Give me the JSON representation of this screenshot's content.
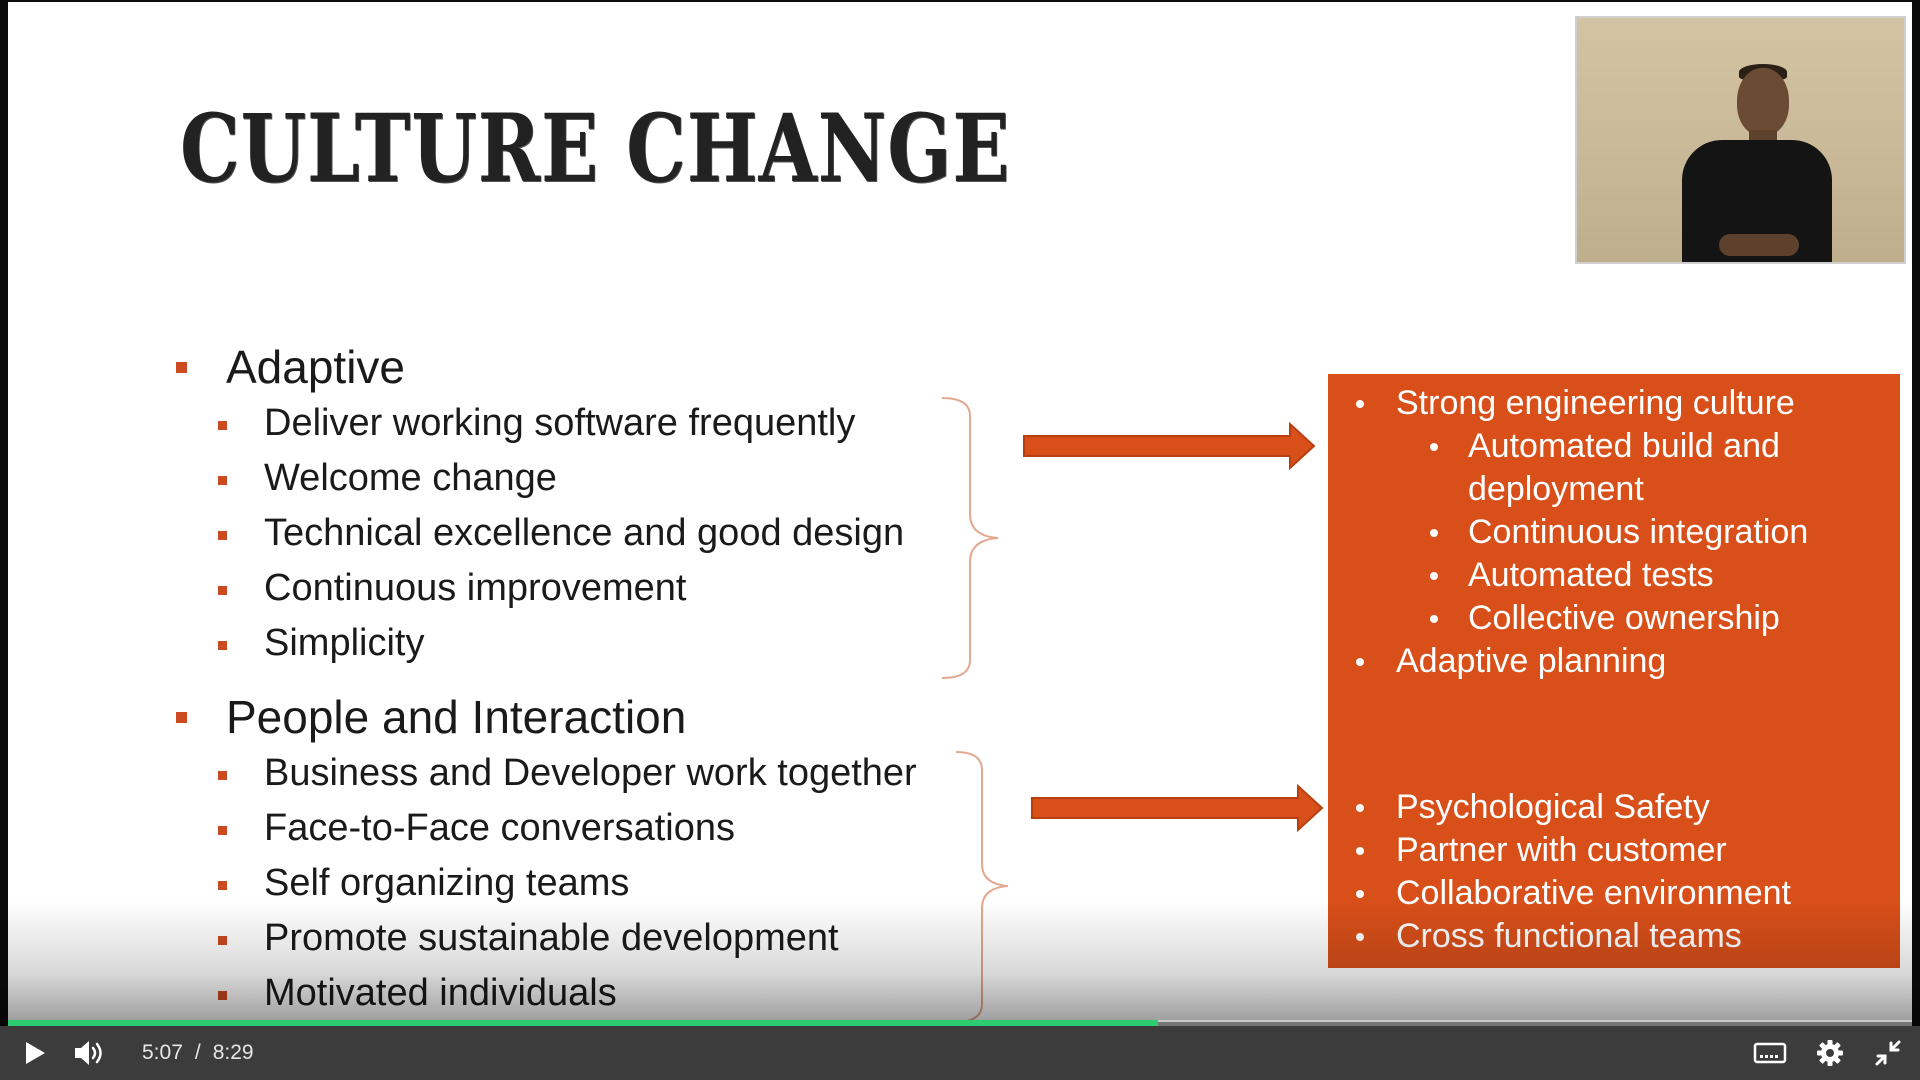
{
  "slide": {
    "title": "CULTURE CHANGE",
    "sections": [
      {
        "heading": "Adaptive",
        "items": [
          "Deliver working software frequently",
          "Welcome change",
          "Technical excellence and good design",
          "Continuous improvement",
          "Simplicity"
        ]
      },
      {
        "heading": "People and Interaction",
        "items": [
          "Business and Developer work together",
          "Face-to-Face conversations",
          "Self organizing teams",
          "Promote sustainable development",
          "Motivated individuals"
        ]
      }
    ],
    "outcome_box": {
      "group1": {
        "heading": "Strong engineering culture",
        "subitems": [
          [
            "Automated build and",
            "deployment"
          ],
          [
            "Continuous integration"
          ],
          [
            "Automated tests"
          ],
          [
            "Collective ownership"
          ]
        ],
        "extra": "Adaptive planning"
      },
      "group2": [
        "Psychological Safety",
        "Partner with customer",
        "Collaborative environment",
        "Cross functional teams"
      ]
    },
    "colors": {
      "accent": "#d84f1a",
      "bullet": "#cc4a1f",
      "title": "#222222"
    }
  },
  "player": {
    "current_time": "5:07",
    "separator": "/",
    "duration": "8:29",
    "progress_fraction": 0.604,
    "icons": {
      "play": "play-icon",
      "volume": "volume-icon",
      "captions": "captions-icon",
      "settings": "gear-icon",
      "exit_fullscreen": "exit-fullscreen-icon"
    },
    "colors": {
      "progress": "#2ecc71",
      "bar": "#3c3c3c"
    }
  }
}
